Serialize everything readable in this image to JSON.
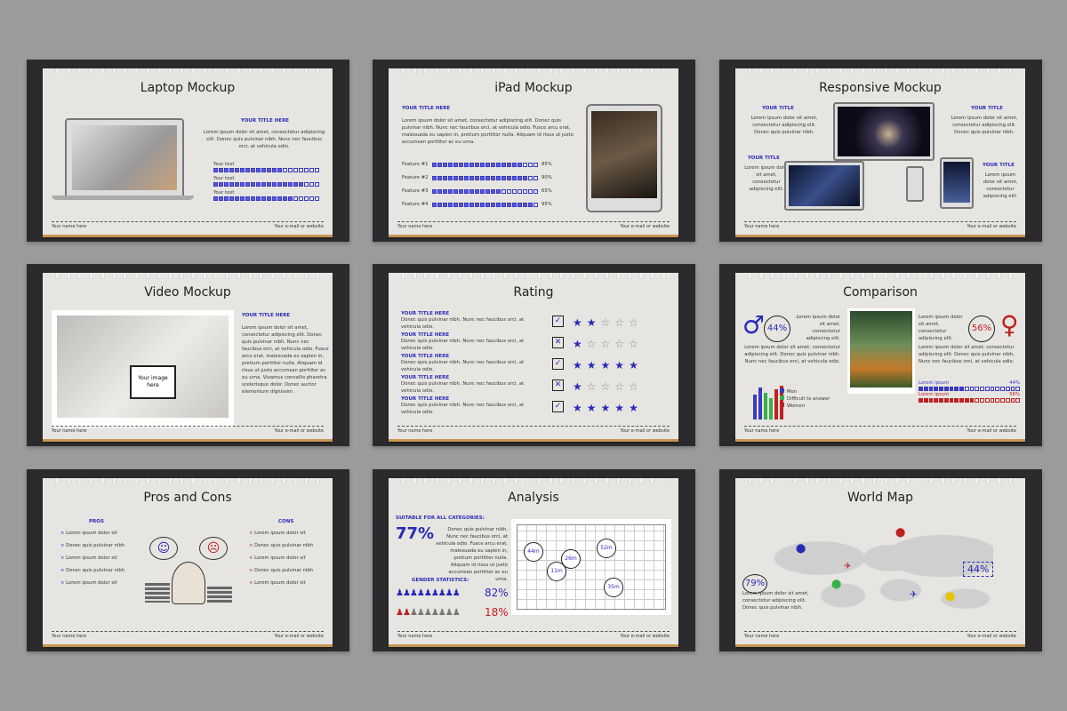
{
  "footer": {
    "left": "Your name here",
    "right": "Your e-mail or website"
  },
  "lorem_short": "Lorem ipsum dolor sit amet, consectetur adipiscing elit.",
  "slides": {
    "laptop": {
      "title": "Laptop Mockup",
      "heading": "YOUR TITLE HERE",
      "body": "Lorem ipsum dolor sit amet, consectetur adipiscing elit. Donec quis pulvinar nibh. Nunc nec faucibus orci, at vehicula odio.",
      "items": [
        {
          "label": "Your text",
          "value": 0.65
        },
        {
          "label": "Your text",
          "value": 0.85
        },
        {
          "label": "Your text",
          "value": 0.75
        }
      ]
    },
    "ipad": {
      "title": "iPad Mockup",
      "heading": "YOUR TITLE HERE",
      "body": "Lorem ipsum dolor sit amet, consectetur adipiscing elit. Donec quis pulvinar nibh. Nunc nec faucibus orci, at vehicula odio. Fusce arcu erat, malesuada eu sapien in, pretium porttitor nulla. Aliquam id risus ut justo accumsan porttitor ac eu urna.",
      "features": [
        {
          "label": "Feature #1",
          "pct": "85%",
          "value": 0.85
        },
        {
          "label": "Feature #2",
          "pct": "90%",
          "value": 0.9
        },
        {
          "label": "Feature #3",
          "pct": "65%",
          "value": 0.65
        },
        {
          "label": "Feature #4",
          "pct": "95%",
          "value": 0.95
        }
      ]
    },
    "responsive": {
      "title": "Responsive Mockup",
      "heading": "YOUR TITLE",
      "body1": "Lorem ipsum dolor sit amet, consectetur adipiscing elit. Donec quis pulvinar nibh.",
      "body2": "Lorem ipsum dolor sit amet, consectetur adipiscing elit.",
      "body3": "Lorem ipsum dolor sit amet, consectetur adipiscing elit."
    },
    "video": {
      "title": "Video Mockup",
      "heading": "YOUR TITLE HERE",
      "placeholder": "Your image here",
      "body": "Lorem ipsum dolor sit amet, consectetur adipiscing elit. Donec quis pulvinar nibh. Nunc nec faucibus orci, at vehicula odio. Fusce arcu erat, malesuada eu sapien in, pretium porttitor nulla. Aliquam id risus ut justo accumsan porttitor ac eu urna. Vivamus convallis pharetra scelerisque dolor. Donec auctor elementum dignissim."
    },
    "rating": {
      "title": "Rating",
      "heading": "YOUR TITLE HERE",
      "body": "Donec quis pulvinar nibh. Nunc nec faucibus orci, at vehicula odio.",
      "rows": [
        {
          "check": "✓",
          "stars": 2
        },
        {
          "check": "✕",
          "stars": 1
        },
        {
          "check": "✓",
          "stars": 5
        },
        {
          "check": "✕",
          "stars": 1
        },
        {
          "check": "✓",
          "stars": 5
        }
      ]
    },
    "comparison": {
      "title": "Comparison",
      "pct_left": "44%",
      "pct_right": "56%",
      "body": "Lorem ipsum dolor sit amet, consectetur adipiscing elit.",
      "body_long": "Lorem ipsum dolor sit amet, consectetur adipiscing elit. Donec quis pulvinar nibh. Nunc nec faucibus orci, at vehicula odio.",
      "legend": [
        "Men",
        "Difficult to answer",
        "Women"
      ],
      "bar1": {
        "label": "Lorem ipsum",
        "pct": "44%",
        "value": 0.44
      },
      "bar2": {
        "label": "Lorem ipsum",
        "pct": "56%",
        "value": 0.56
      }
    },
    "pros": {
      "title": "Pros and Cons",
      "pros_label": "PROS",
      "cons_label": "CONS",
      "pros": [
        "Lorem ipsum dolor sit",
        "Donec quis pulvinar nibh",
        "Lorem ipsum dolor sit",
        "Donec quis pulvinar nibh",
        "Lorem ipsum dolor sit"
      ],
      "cons": [
        "Lorem ipsum dolor sit",
        "Donec quis pulvinar nibh",
        "Lorem ipsum dolor sit",
        "Donec quis pulvinar nibh",
        "Lorem ipsum dolor sit"
      ]
    },
    "analysis": {
      "title": "Analysis",
      "suitable": "SUITABLE FOR ALL CATEGORIES:",
      "pct": "77%",
      "body": "Donec quis pulvinar nibh. Nunc nec faucibus orci, at vehicula odio. Fusce arcu erat, malesuada eu sapien in, pretium porttitor nulla. Aliquam id risus ut justo accumsan porttitor ac eu urna.",
      "gender": "GENDER STATISTICS:",
      "stat1": "82%",
      "stat2": "18%",
      "bubbles": [
        "44m",
        "26m",
        "52m",
        "11m",
        "35m"
      ]
    },
    "world": {
      "title": "World Map",
      "pct_left": "79%",
      "pct_right": "44%",
      "body": "Lorem ipsum dolor sit amet, consectetur adipiscing elit. Donec quis pulvinar nibh."
    }
  }
}
